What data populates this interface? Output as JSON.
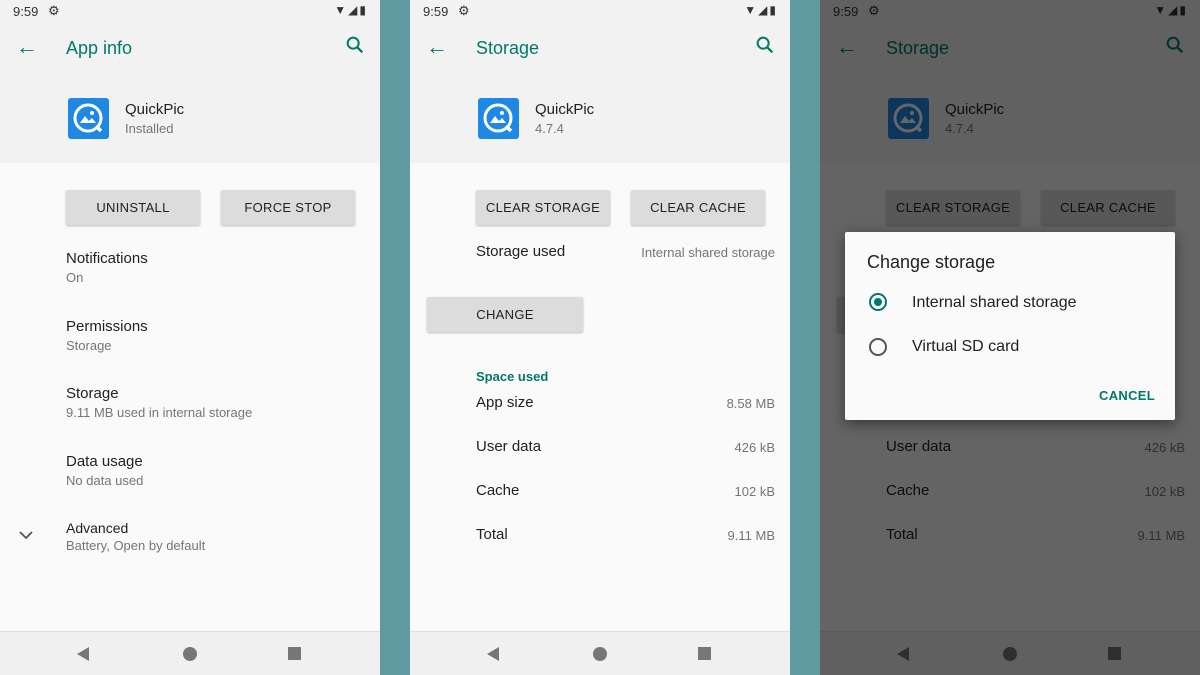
{
  "status": {
    "time": "9:59"
  },
  "phone1": {
    "title": "App info",
    "app_name": "QuickPic",
    "app_status": "Installed",
    "btn_uninstall": "UNINSTALL",
    "btn_force_stop": "FORCE STOP",
    "rows": [
      {
        "title": "Notifications",
        "sub": "On"
      },
      {
        "title": "Permissions",
        "sub": "Storage"
      },
      {
        "title": "Storage",
        "sub": "9.11 MB used in internal storage"
      },
      {
        "title": "Data usage",
        "sub": "No data used"
      },
      {
        "title": "Advanced",
        "sub": "Battery, Open by default"
      }
    ]
  },
  "phone2": {
    "title": "Storage",
    "app_name": "QuickPic",
    "app_version": "4.7.4",
    "btn_clear_storage": "CLEAR STORAGE",
    "btn_clear_cache": "CLEAR CACHE",
    "storage_used_label": "Storage used",
    "storage_used_value": "Internal shared storage",
    "btn_change": "CHANGE",
    "section_space": "Space used",
    "space": [
      {
        "label": "App size",
        "value": "8.58 MB"
      },
      {
        "label": "User data",
        "value": "426 kB"
      },
      {
        "label": "Cache",
        "value": "102 kB"
      },
      {
        "label": "Total",
        "value": "9.11 MB"
      }
    ]
  },
  "dialog": {
    "title": "Change storage",
    "options": [
      "Internal shared storage",
      "Virtual SD card"
    ],
    "selected": "Internal shared storage",
    "cancel": "CANCEL"
  },
  "colors": {
    "accent": "#00796b",
    "app_icon": "#1e88e5",
    "background": "#5e9aa0"
  },
  "icons": [
    "back-arrow-icon",
    "search-icon",
    "settings-gear-icon",
    "wifi-icon",
    "signal-icon",
    "battery-icon",
    "chevron-down-icon",
    "quickpic-app-icon"
  ]
}
